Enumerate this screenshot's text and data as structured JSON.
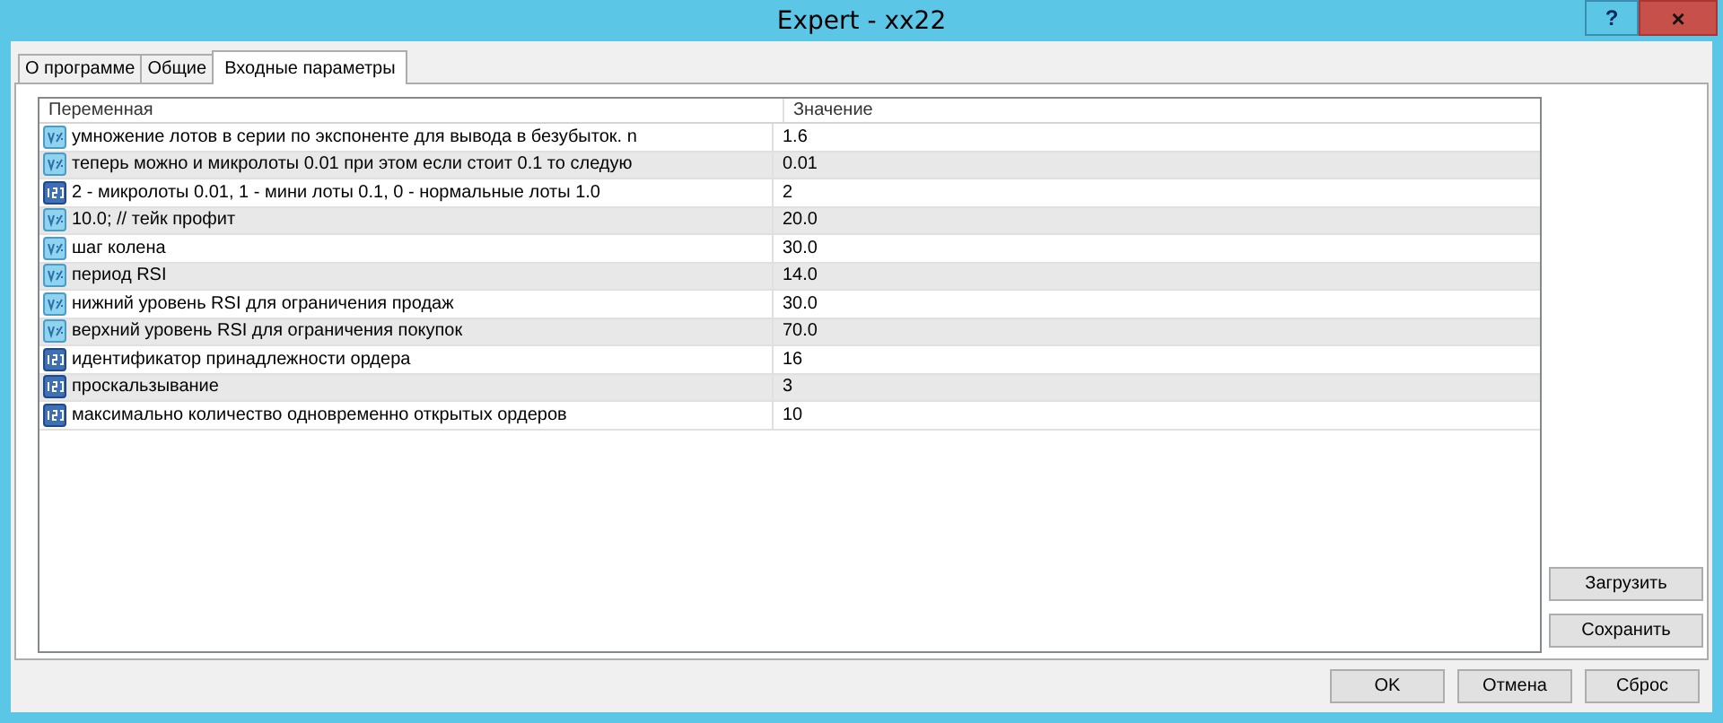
{
  "window": {
    "title": "Expert - xx22",
    "help": "?",
    "close": "×"
  },
  "tabs": [
    {
      "label": "О программе",
      "selected": false
    },
    {
      "label": "Общие",
      "selected": false
    },
    {
      "label": "Входные параметры",
      "selected": true
    }
  ],
  "table": {
    "columns": [
      "Переменная",
      "Значение"
    ],
    "rows": [
      {
        "kind": "double",
        "name": "умножение лотов в серии по экспоненте для вывода в безубыток. n",
        "value": "1.6"
      },
      {
        "kind": "double",
        "name": "теперь можно и микролоты 0.01 при этом если стоит 0.1 то следую",
        "value": "0.01"
      },
      {
        "kind": "int",
        "name": "2 - микролоты 0.01, 1 - мини лоты 0.1, 0 - нормальные лоты 1.0",
        "value": "2"
      },
      {
        "kind": "double",
        "name": "10.0; // тейк профит",
        "value": "20.0"
      },
      {
        "kind": "double",
        "name": "шаг колена",
        "value": "30.0"
      },
      {
        "kind": "double",
        "name": "период RSI",
        "value": "14.0"
      },
      {
        "kind": "double",
        "name": "нижний уровень RSI для ограничения продаж",
        "value": "30.0"
      },
      {
        "kind": "double",
        "name": "верхний уровень RSI для ограничения покупок",
        "value": "70.0"
      },
      {
        "kind": "int",
        "name": "идентификатор принадлежности ордера",
        "value": "16"
      },
      {
        "kind": "int",
        "name": "проскальзывание",
        "value": "3"
      },
      {
        "kind": "int",
        "name": "максимально количество одновременно открытых ордеров",
        "value": "10"
      }
    ]
  },
  "side_buttons": [
    "Загрузить",
    "Сохранить"
  ],
  "buttons": [
    "OK",
    "Отмена",
    "Сброс"
  ]
}
